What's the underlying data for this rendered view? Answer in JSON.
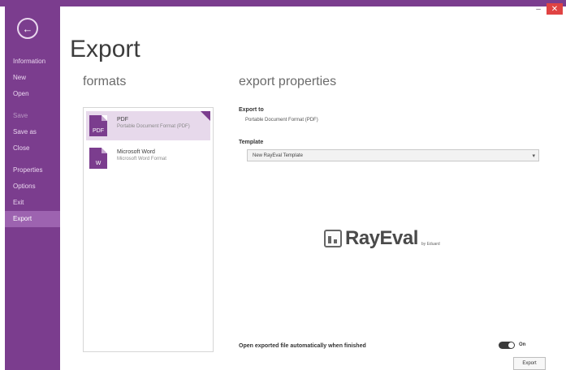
{
  "window": {
    "minimize_glyph": "–",
    "close_glyph": "✕"
  },
  "sidebar": {
    "back_icon": "arrow-left-circle-icon",
    "items": [
      {
        "label": "Information",
        "state": "normal"
      },
      {
        "label": "New",
        "state": "normal"
      },
      {
        "label": "Open",
        "state": "normal"
      },
      {
        "label": "Save",
        "state": "disabled"
      },
      {
        "label": "Save as",
        "state": "normal"
      },
      {
        "label": "Close",
        "state": "normal"
      },
      {
        "label": "Properties",
        "state": "normal"
      },
      {
        "label": "Options",
        "state": "normal"
      },
      {
        "label": "Exit",
        "state": "normal"
      },
      {
        "label": "Export",
        "state": "active"
      }
    ]
  },
  "page": {
    "title": "Export",
    "formats_heading": "formats",
    "properties_heading": "export properties"
  },
  "formats": [
    {
      "name": "PDF",
      "description": "Portable Document Format (PDF)",
      "icon": "pdf-file-icon",
      "icon_text": "PDF",
      "selected": true
    },
    {
      "name": "Microsoft Word",
      "description": "Microsoft Word Format",
      "icon": "word-file-icon",
      "icon_text": "W",
      "selected": false
    }
  ],
  "export_properties": {
    "export_to_label": "Export to",
    "export_to_value": "Portable Document Format (PDF)",
    "template_label": "Template",
    "template_value": "New RayEval Template",
    "logo_text": "RayEval",
    "logo_by": "by Eduard",
    "auto_open_label": "Open exported file automatically when finished",
    "auto_open_state": "on",
    "auto_open_state_text": "On"
  },
  "footer": {
    "export_button": "Export"
  },
  "colors": {
    "accent": "#7b3d8e",
    "active_nav": "#9d63b0",
    "selected_format": "#e7d9eb",
    "close_button": "#e04343"
  }
}
